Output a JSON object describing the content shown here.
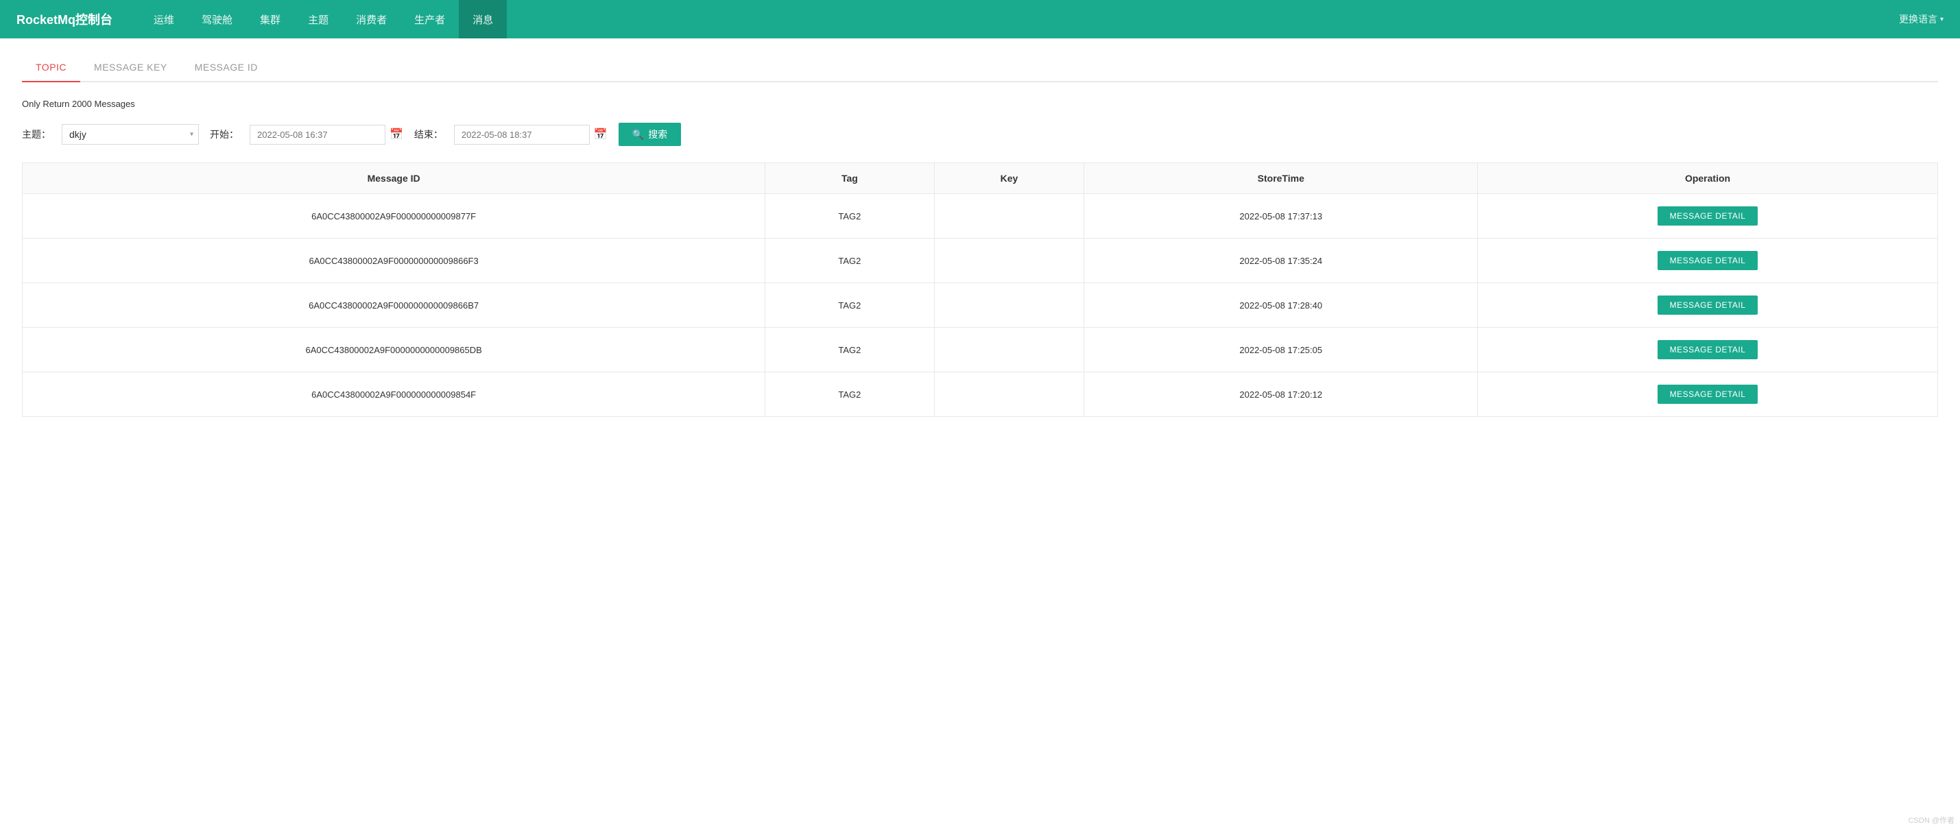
{
  "navbar": {
    "brand": "RocketMq控制台",
    "items": [
      {
        "label": "运维",
        "active": false
      },
      {
        "label": "驾驶舱",
        "active": false
      },
      {
        "label": "集群",
        "active": false
      },
      {
        "label": "主题",
        "active": false
      },
      {
        "label": "消费者",
        "active": false
      },
      {
        "label": "生产者",
        "active": false
      },
      {
        "label": "消息",
        "active": true
      }
    ],
    "language_btn": "更换语言"
  },
  "tabs": [
    {
      "label": "TOPIC",
      "active": true
    },
    {
      "label": "MESSAGE KEY",
      "active": false
    },
    {
      "label": "MESSAGE ID",
      "active": false
    }
  ],
  "info_text": "Only Return 2000 Messages",
  "search_form": {
    "topic_label": "主题：",
    "topic_value": "dkjy",
    "start_label": "开始：",
    "start_placeholder": "2022-05-08 16:37",
    "end_label": "结束：",
    "end_placeholder": "2022-05-08 18:37",
    "search_btn": "搜索"
  },
  "table": {
    "headers": [
      "Message ID",
      "Tag",
      "Key",
      "StoreTime",
      "Operation"
    ],
    "rows": [
      {
        "message_id": "6A0CC43800002A9F000000000009877F",
        "tag": "TAG2",
        "key": "",
        "store_time": "2022-05-08 17:37:13",
        "operation": "MESSAGE DETAIL"
      },
      {
        "message_id": "6A0CC43800002A9F000000000009866F3",
        "tag": "TAG2",
        "key": "",
        "store_time": "2022-05-08 17:35:24",
        "operation": "MESSAGE DETAIL"
      },
      {
        "message_id": "6A0CC43800002A9F000000000009866B7",
        "tag": "TAG2",
        "key": "",
        "store_time": "2022-05-08 17:28:40",
        "operation": "MESSAGE DETAIL"
      },
      {
        "message_id": "6A0CC43800002A9F0000000000009865DB",
        "tag": "TAG2",
        "key": "",
        "store_time": "2022-05-08 17:25:05",
        "operation": "MESSAGE DETAIL"
      },
      {
        "message_id": "6A0CC43800002A9F000000000009854F",
        "tag": "TAG2",
        "key": "",
        "store_time": "2022-05-08 17:20:12",
        "operation": "MESSAGE DETAIL"
      }
    ]
  },
  "colors": {
    "primary": "#1aaa8e",
    "active_tab": "#e84646"
  }
}
